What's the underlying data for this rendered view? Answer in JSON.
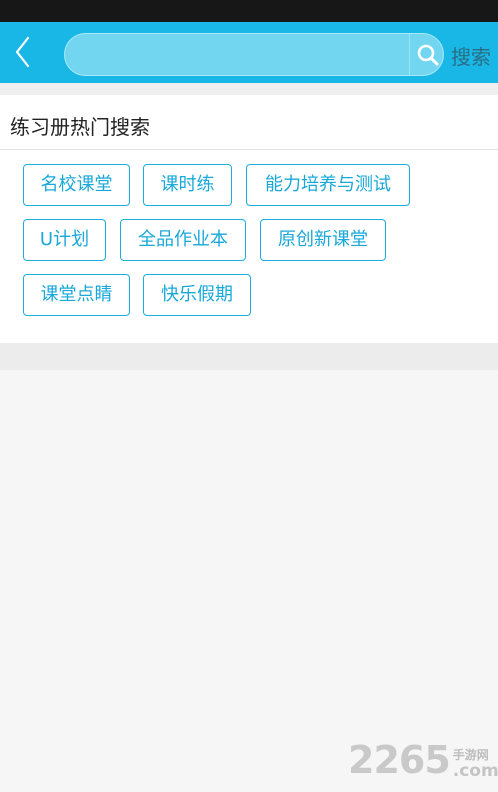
{
  "header": {
    "search_placeholder": "",
    "search_button_label": "搜索"
  },
  "hot_search": {
    "title": "练习册热门搜索",
    "tags": [
      "名校课堂",
      "课时练",
      "能力培养与测试",
      "U计划",
      "全品作业本",
      "原创新课堂",
      "课堂点睛",
      "快乐假期"
    ]
  },
  "watermark": {
    "number": "2265",
    "suffix_cn": "手游网",
    "suffix_domain": ".com"
  },
  "colors": {
    "header_bg": "#19b7e6",
    "search_box_bg": "#72d6f1",
    "tag_accent": "#19b0e0",
    "status_bar": "#171717"
  }
}
